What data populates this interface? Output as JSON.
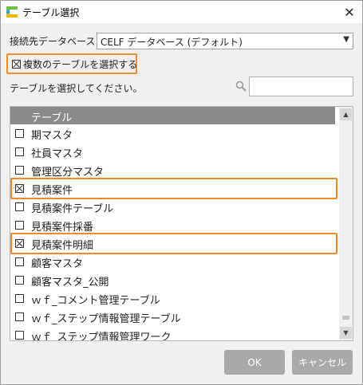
{
  "window": {
    "title": "テーブル選択",
    "close_glyph": "✕",
    "logo_icon": "app-logo-icon"
  },
  "database": {
    "label": "接続先データベース",
    "selected": "CELF データベース (デフォルト)",
    "arrow_glyph": "▼"
  },
  "multi_select": {
    "label": "複数のテーブルを選択する",
    "checked": true
  },
  "search": {
    "hint": "テーブルを選択してください。",
    "placeholder": "",
    "value": ""
  },
  "table_list": {
    "header": "テーブル",
    "rows": [
      {
        "label": "期マスタ",
        "checked": false
      },
      {
        "label": "社員マスタ",
        "checked": false
      },
      {
        "label": "管理区分マスタ",
        "checked": false
      },
      {
        "label": "見積案件",
        "checked": true
      },
      {
        "label": "見積案件テーブル",
        "checked": false
      },
      {
        "label": "見積案件採番",
        "checked": false
      },
      {
        "label": "見積案件明細",
        "checked": true
      },
      {
        "label": "顧客マスタ",
        "checked": false
      },
      {
        "label": "顧客マスタ_公開",
        "checked": false
      },
      {
        "label": "ｗｆ_コメント管理テーブル",
        "checked": false
      },
      {
        "label": "ｗｆ_ステップ情報管理テーブル",
        "checked": false
      },
      {
        "label": "ｗｆ_ステップ情報管理ワーク",
        "checked": false
      }
    ],
    "scroll_up_glyph": "▲",
    "scroll_down_glyph": "▼"
  },
  "buttons": {
    "ok": "OK",
    "cancel": "キャンセル"
  },
  "colors": {
    "highlight": "#f08a2a",
    "header_bg": "#8a8a8a",
    "button_bg": "#a9a9a9"
  }
}
